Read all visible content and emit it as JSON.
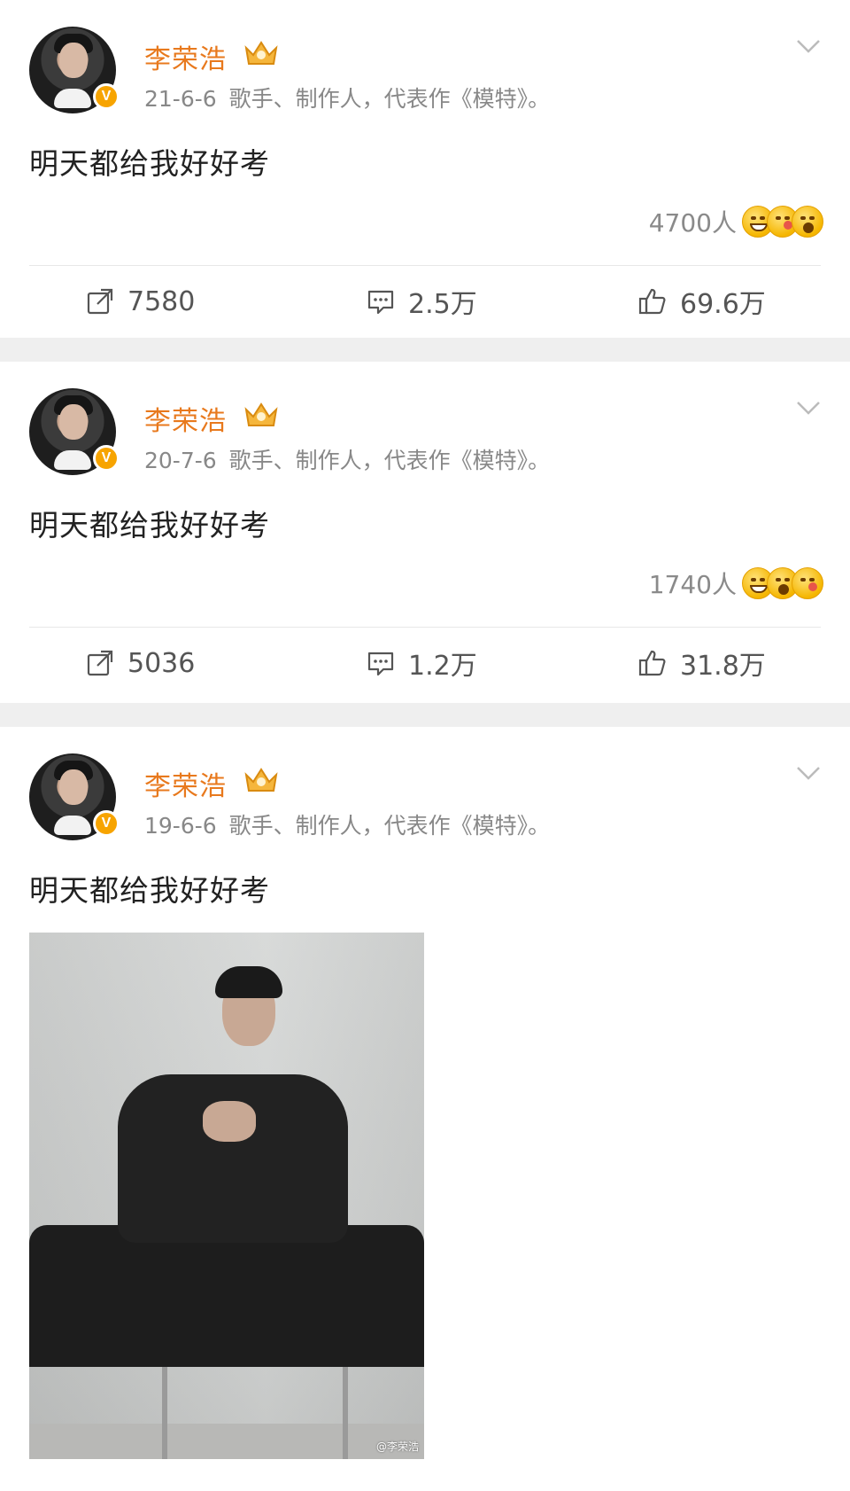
{
  "colors": {
    "username": "#e8791d",
    "verified_badge": "#f7a400",
    "meta_text": "#888888",
    "page_bg": "#efefef"
  },
  "posts": [
    {
      "username": "李荣浩",
      "date": "21-6-6",
      "bio": "歌手、制作人，代表作《模特》。",
      "content": "明天都给我好好考",
      "reactions_count": "4700人",
      "reaction_icons": [
        "grinning-emoji",
        "kiss-emoji",
        "wow-emoji"
      ],
      "shares": "7580",
      "comments": "2.5万",
      "likes": "69.6万",
      "verified_label": "V"
    },
    {
      "username": "李荣浩",
      "date": "20-7-6",
      "bio": "歌手、制作人，代表作《模特》。",
      "content": "明天都给我好好考",
      "reactions_count": "1740人",
      "reaction_icons": [
        "grinning-emoji",
        "wow-emoji",
        "kiss-emoji"
      ],
      "shares": "5036",
      "comments": "1.2万",
      "likes": "31.8万",
      "verified_label": "V"
    },
    {
      "username": "李荣浩",
      "date": "19-6-6",
      "bio": "歌手、制作人，代表作《模特》。",
      "content": "明天都给我好好考",
      "image_watermark": "@李荣浩",
      "verified_label": "V"
    }
  ]
}
